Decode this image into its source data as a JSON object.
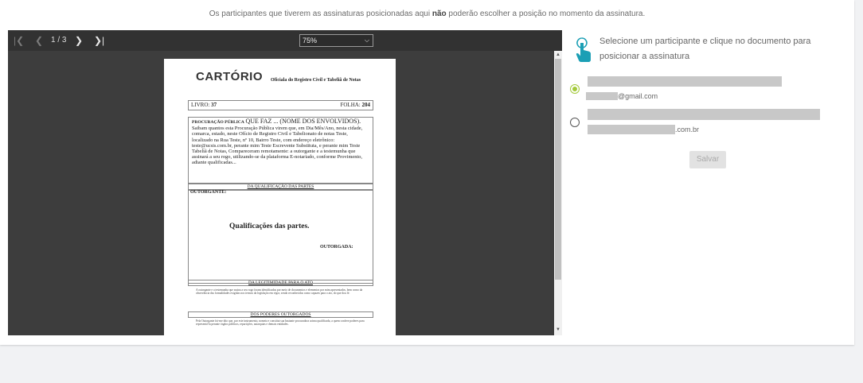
{
  "notice": {
    "before": "Os participantes que tiverem as assinaturas posicionadas aqui ",
    "bold": "não",
    "after": " poderão escolher a posição no momento da assinatura."
  },
  "viewer": {
    "page_info": "1 / 3",
    "zoom": "75%"
  },
  "document": {
    "logo": "CARTÓRIO",
    "office": "Oficiala do Registro Civil e Tabeliã de Notas",
    "livro_label": "LIVRO:",
    "livro_value": "37",
    "folha_label": "FOLHA:",
    "folha_value": "204",
    "proc_title": "PROCURAÇÃO PÚBLICA",
    "proc_heading": "QUE FAZ ... (NOME DOS ENVOLVIDOS).",
    "proc_body": "Saibam quantos esta Procuração Pública virem que, em Dia/Mês/Ano, nesta cidade, comarca, estado, neste Ofício de Registro Civil e Tabelionato de notas Teste, localizado na Rua Teste, nº 10, Bairro Teste, com endereço eletrônico: teste@ucsis.com.br, perante mim Teste Escrevente Substituta, e perante mim Teste Tabeliã de Notas, Compareceram remotamente: a outorgante e a testemunha que assinará a seu rogo, utilizando-se da plataforma E-notariado, conforme Provimento, adiante qualificadas...",
    "sec_qualificacao": "DA QUALIFICAÇÃO DAS PARTES",
    "outorgante": "OUTORGANTE:",
    "qualificacoes": "Qualificações das partes.",
    "outorgada": "OUTORGADA:",
    "sec_legitimidade": "DA LEGITIMIDADE PARA O ATO",
    "legit_text": "A outorgante e a testemunha que assina a seu rogo foram identificadas por meio de documentos e elementos por mim apresentados, bem como da observância das formalidades exigidas nos termos da legislação em vigor, sendo reconhecidas como capazes para o ato, do que dou fé.",
    "sec_poderes": "DOS PODERES OUTORGADOS",
    "poderes_text": "Pela Outorgante foi-me dito que, por este instrumento, nomeia e constitui sua bastante procuradora acima qualificada, a quem confere poderes para representá-la perante órgãos públicos, repartições, autarquias e demais entidades."
  },
  "panel": {
    "instruction": "Selecione um participante e clique no documento para posicionar a assinatura",
    "participants": [
      {
        "email": "@gmail.com",
        "selected": true
      },
      {
        "email": ".com.br",
        "selected": false
      }
    ],
    "save_label": "Salvar",
    "accent_color": "#a3c93a",
    "icon_color": "#1b9fb5"
  }
}
